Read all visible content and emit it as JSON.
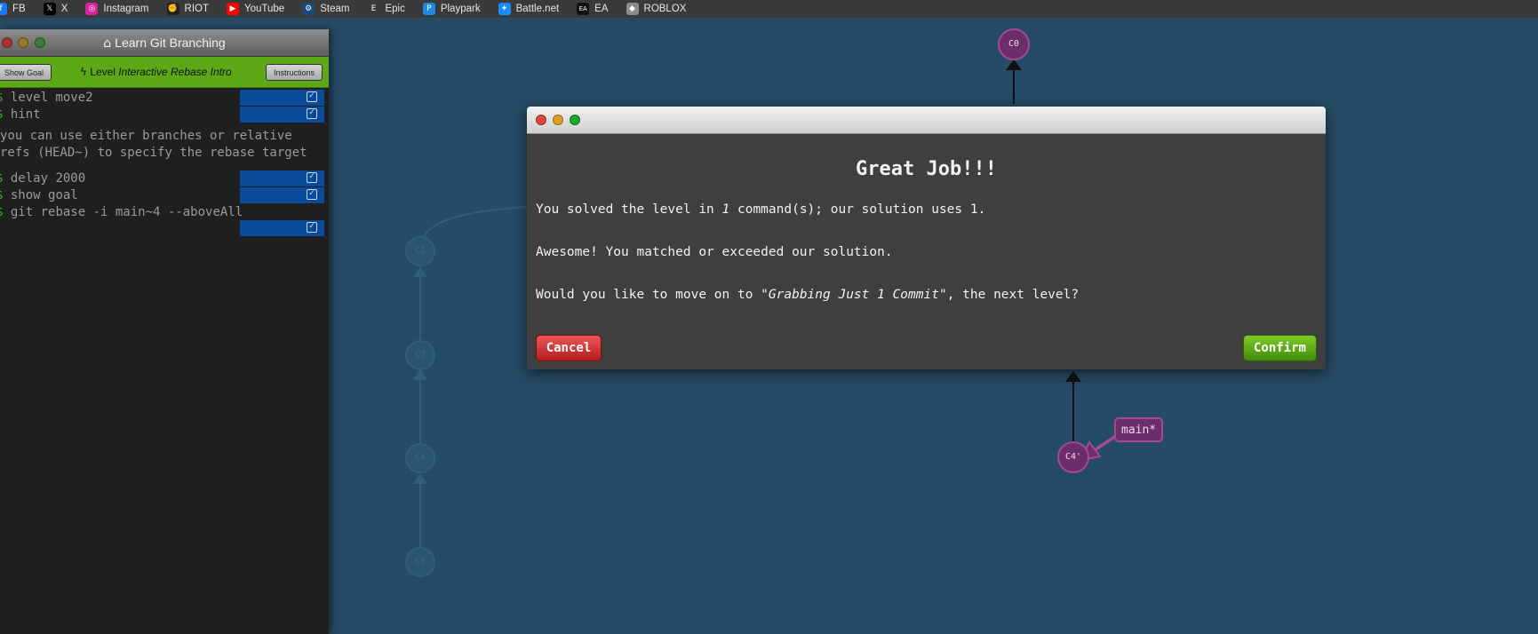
{
  "bookmarks": [
    {
      "label": "FB",
      "icon": "facebook-icon",
      "color": "#1877f2",
      "glyph": "f"
    },
    {
      "label": "X",
      "icon": "x-icon",
      "color": "#000000",
      "glyph": "𝕏"
    },
    {
      "label": "Instagram",
      "icon": "instagram-icon",
      "color": "#d6249f",
      "glyph": "◎"
    },
    {
      "label": "RIOT",
      "icon": "riot-icon",
      "color": "#222222",
      "glyph": "✊"
    },
    {
      "label": "YouTube",
      "icon": "youtube-icon",
      "color": "#ff0000",
      "glyph": "▶"
    },
    {
      "label": "Steam",
      "icon": "steam-icon",
      "color": "#1b4a7a",
      "glyph": "⚙"
    },
    {
      "label": "Epic",
      "icon": "epic-icon",
      "color": "#3a3a3a",
      "glyph": "E"
    },
    {
      "label": "Playpark",
      "icon": "playpark-icon",
      "color": "#1e88e5",
      "glyph": "P"
    },
    {
      "label": "Battle.net",
      "icon": "battlenet-icon",
      "color": "#148eff",
      "glyph": "✦"
    },
    {
      "label": "EA",
      "icon": "ea-icon",
      "color": "#111111",
      "glyph": "EA"
    },
    {
      "label": "ROBLOX",
      "icon": "roblox-icon",
      "color": "#8a8a8a",
      "glyph": "◆"
    }
  ],
  "terminal": {
    "title": "Learn Git Branching",
    "show_goal": "Show Goal",
    "instructions": "Instructions",
    "level_prefix": "Level",
    "level_name": "Interactive Rebase Intro",
    "commands": [
      {
        "prompt": "$",
        "text": "level move2"
      },
      {
        "prompt": "$",
        "text": "hint"
      },
      {
        "prompt": "$",
        "text": "delay 2000"
      },
      {
        "prompt": "$",
        "text": "show goal"
      },
      {
        "prompt": "$",
        "text": "git rebase -i main~4 --aboveAll"
      }
    ],
    "hint_line1": "you can use either branches or relative",
    "hint_line2": "refs (HEAD~) to specify the rebase target"
  },
  "tree": {
    "nodes": [
      {
        "id": "C0",
        "style": "active"
      },
      {
        "id": "C2",
        "style": "faded"
      },
      {
        "id": "C3",
        "style": "faded"
      },
      {
        "id": "C4",
        "style": "faded"
      },
      {
        "id": "C5",
        "style": "faded"
      },
      {
        "id": "C4'",
        "style": "active"
      }
    ],
    "branch_label": "main*"
  },
  "dialog": {
    "heading": "Great Job!!!",
    "line1_a": "You solved the level in ",
    "line1_count": "1",
    "line1_b": " command(s); our solution uses 1.",
    "line2": "Awesome! You matched or exceeded our solution.",
    "line3_a": "Would you like to move on to ",
    "line3_level": "\"Grabbing Just 1 Commit\"",
    "line3_b": ", the next level?",
    "cancel": "Cancel",
    "confirm": "Confirm"
  },
  "colors": {
    "background": "#264b66",
    "commit_active": "#6b2d6b",
    "level_bar": "#5ca817"
  }
}
